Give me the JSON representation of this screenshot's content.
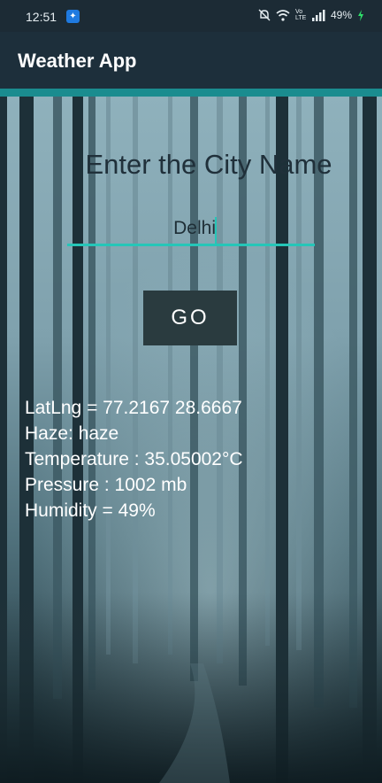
{
  "status_bar": {
    "time": "12:51",
    "app_badge_icon": "app-notification-icon",
    "battery": "49%",
    "icons": [
      "mute-icon",
      "wifi-icon",
      "volte-icon",
      "signal-icon",
      "battery-charging-icon"
    ],
    "volte_label": "Vo LTE"
  },
  "app_bar": {
    "title": "Weather App",
    "background_color": "#1d2f3b",
    "accent_color": "#1a8c8f"
  },
  "form": {
    "prompt": "Enter the City Name",
    "city_value": "Delhi",
    "go_label": "GO",
    "underline_color": "#25c6b8"
  },
  "weather": {
    "latlng": "LatLng = 77.2167  28.6667",
    "haze": "Haze: haze",
    "temperature": "Temperature : 35.05002°C",
    "pressure": "Pressure : 1002 mb",
    "humidity": "Humidity = 49%"
  }
}
